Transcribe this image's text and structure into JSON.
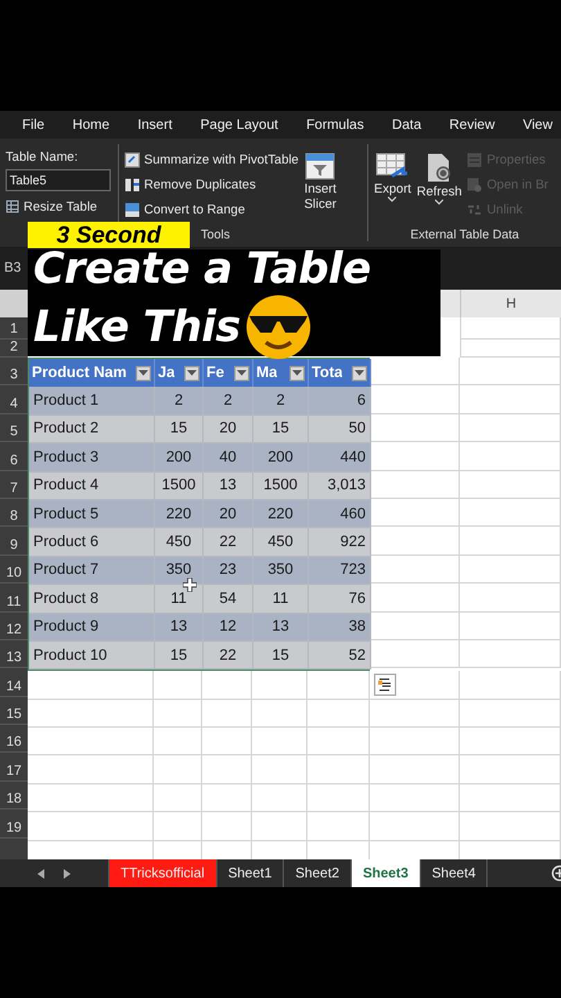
{
  "menu": [
    "File",
    "Home",
    "Insert",
    "Page Layout",
    "Formulas",
    "Data",
    "Review",
    "View"
  ],
  "ribbon": {
    "table_name_label": "Table Name:",
    "table_name": "Table5",
    "resize": "Resize Table",
    "tools": [
      {
        "kind": "pivot",
        "label": "Summarize with PivotTable"
      },
      {
        "kind": "duplicates",
        "label": "Remove Duplicates"
      },
      {
        "kind": "range",
        "label": "Convert to Range"
      }
    ],
    "tools_label": "Tools",
    "slicer": [
      "Insert",
      "Slicer"
    ],
    "big_buttons": [
      {
        "kind": "export",
        "label": "Export"
      },
      {
        "kind": "refresh",
        "label": "Refresh"
      }
    ],
    "external_items": [
      {
        "kind": "properties",
        "label": "Properties",
        "disabled": true
      },
      {
        "kind": "browser",
        "label": "Open in Br",
        "disabled": true
      },
      {
        "kind": "unlink",
        "label": "Unlink",
        "disabled": true
      }
    ],
    "external_label": "External Table Data"
  },
  "name_box": "B3",
  "column_headers": [
    "H"
  ],
  "row_numbers": [
    "1",
    "2",
    "3",
    "4",
    "5",
    "6",
    "7",
    "8",
    "9",
    "10",
    "11",
    "12",
    "13",
    "14",
    "15",
    "16",
    "17",
    "18",
    "19"
  ],
  "table": {
    "columns": [
      "Product Nam",
      "Ja",
      "Fe",
      "Ma",
      "Tota"
    ],
    "rows": [
      [
        "Product 1",
        "2",
        "2",
        "2",
        "6"
      ],
      [
        "Product 2",
        "15",
        "20",
        "15",
        "50"
      ],
      [
        "Product 3",
        "200",
        "40",
        "200",
        "440"
      ],
      [
        "Product 4",
        "1500",
        "13",
        "1500",
        "3,013"
      ],
      [
        "Product 5",
        "220",
        "20",
        "220",
        "460"
      ],
      [
        "Product 6",
        "450",
        "22",
        "450",
        "922"
      ],
      [
        "Product 7",
        "350",
        "23",
        "350",
        "723"
      ],
      [
        "Product 8",
        "11",
        "54",
        "11",
        "76"
      ],
      [
        "Product 9",
        "13",
        "12",
        "13",
        "38"
      ],
      [
        "Product 10",
        "15",
        "22",
        "15",
        "52"
      ]
    ]
  },
  "overlay": {
    "caption": "3 Second",
    "title_lines": [
      "Create a Table",
      "Like This"
    ]
  },
  "sheet_tabs": [
    {
      "label": "TTricksofficial",
      "selected": false,
      "color": "#ff1a12"
    },
    {
      "label": "Sheet1",
      "selected": false
    },
    {
      "label": "Sheet2",
      "selected": false
    },
    {
      "label": "Sheet3",
      "selected": true
    },
    {
      "label": "Sheet4",
      "selected": false
    }
  ]
}
